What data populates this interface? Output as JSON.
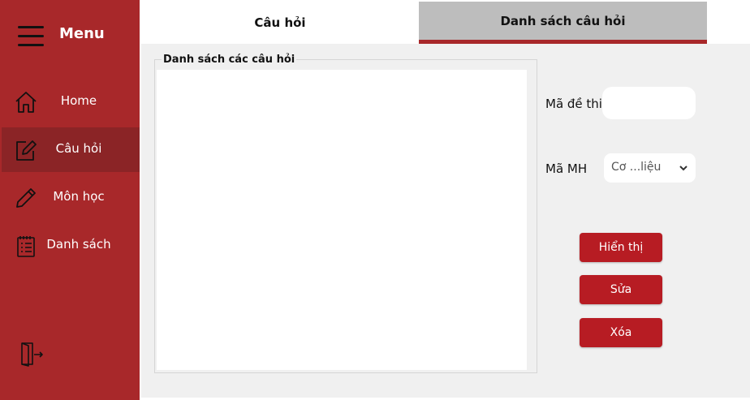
{
  "sidebar": {
    "menu_label": "Menu",
    "items": [
      {
        "label": "Home",
        "icon": "home-icon"
      },
      {
        "label": "Câu hỏi",
        "icon": "edit-icon",
        "active": true
      },
      {
        "label": "Môn học",
        "icon": "pencil-icon"
      },
      {
        "label": "Danh sách",
        "icon": "clipboard-list-icon"
      }
    ],
    "logout_icon": "logout-icon"
  },
  "tabs": [
    {
      "label": "Câu hỏi",
      "selected": true
    },
    {
      "label": "Danh sách câu hỏi",
      "selected": false
    }
  ],
  "main": {
    "group_title": "Danh sách các câu hỏi",
    "exam_code_label": "Mã đề thi",
    "exam_code_value": "",
    "subject_label": "Mã MH",
    "subject_value": "Cơ ...liệu",
    "buttons": {
      "show": "Hiển thị",
      "edit": "Sửa",
      "delete": "Xóa"
    }
  },
  "colors": {
    "sidebar_bg": "#a8282a",
    "active_item_bg": "#8b2426",
    "button_bg": "#b71c23",
    "tab_inactive_bg": "#bdbdbd",
    "content_bg": "#f0f0f0"
  }
}
